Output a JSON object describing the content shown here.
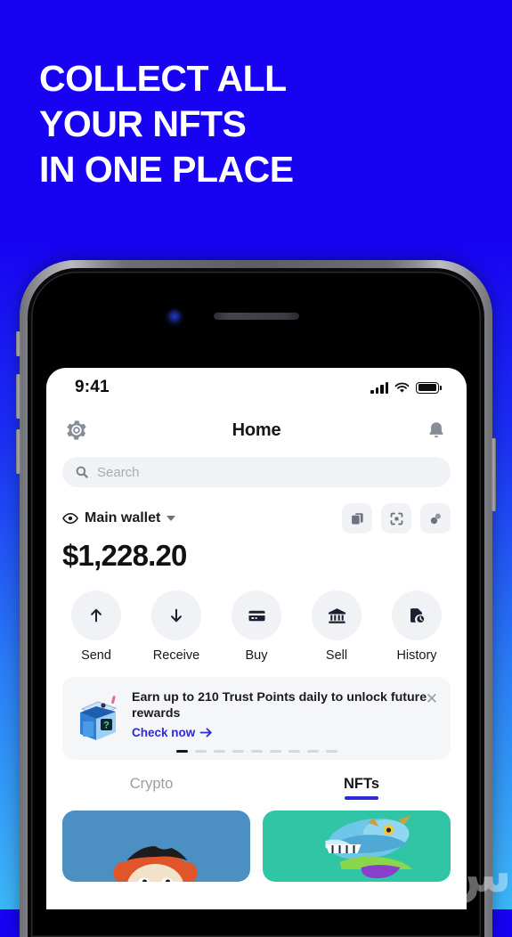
{
  "promo": {
    "headline_lines": [
      "COLLECT ALL",
      "YOUR NFTS",
      "IN ONE PLACE"
    ],
    "background_top_color": "#1702f2",
    "background_bottom_color": "#3cb6f6"
  },
  "status_bar": {
    "time": "9:41",
    "signal_icon": "cellular-signal-icon",
    "wifi_icon": "wifi-icon",
    "battery_icon": "battery-full-icon"
  },
  "app_header": {
    "settings_icon": "gear-icon",
    "title": "Home",
    "notifications_icon": "bell-icon"
  },
  "search": {
    "icon": "search-icon",
    "placeholder": "Search"
  },
  "wallet": {
    "visibility_icon": "eye-icon",
    "name": "Main wallet",
    "dropdown_icon": "chevron-down-icon",
    "balance": "$1,228.20",
    "actions": [
      {
        "name": "copy-address",
        "icon": "copy-icon"
      },
      {
        "name": "scan-qr",
        "icon": "qr-scan-icon"
      },
      {
        "name": "connect-dapp",
        "icon": "link-icon"
      }
    ]
  },
  "quick_actions": [
    {
      "label": "Send",
      "icon": "arrow-up-icon"
    },
    {
      "label": "Receive",
      "icon": "arrow-down-icon"
    },
    {
      "label": "Buy",
      "icon": "credit-card-icon"
    },
    {
      "label": "Sell",
      "icon": "bank-icon"
    },
    {
      "label": "History",
      "icon": "history-icon"
    }
  ],
  "banner": {
    "illustration": "mystery-box-icon",
    "title": "Earn up to 210 Trust Points daily to unlock future rewards",
    "link_label": "Check now",
    "link_arrow": "arrow-right-icon",
    "close_icon": "close-icon",
    "dot_count": 9,
    "active_dot_index": 0,
    "accent_color": "#2b2bd8"
  },
  "tabs": [
    {
      "label": "Crypto",
      "active": false
    },
    {
      "label": "NFTs",
      "active": true
    }
  ],
  "nft_cards": [
    {
      "name": "nft-card-ape",
      "background_color": "#4c8fc3"
    },
    {
      "name": "nft-card-fish",
      "background_color": "#2fc5a5"
    }
  ],
  "watermark": {
    "text": "س"
  }
}
